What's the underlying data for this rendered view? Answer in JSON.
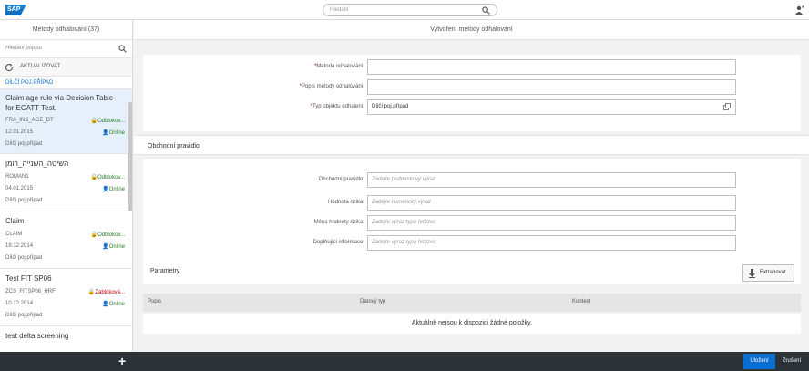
{
  "header": {
    "logo": "SAP",
    "search_placeholder": "Hledání"
  },
  "master": {
    "title": "Metody odhalování (37)",
    "search_placeholder": "Hledání popisu",
    "refresh_label": "AKTUALIZOVAT",
    "group_label": "DÍLČÍ POJ.PŘÍPAD",
    "items": [
      {
        "title1": "Claim age rule via Decision Table",
        "title2": "for ECATT Test.",
        "id": "FRA_INS_AGE_DT",
        "date": "12.01.2015",
        "type": "Dílčí poj.případ",
        "status1": "Odblokov...",
        "status2": "Online",
        "status1_color": "green"
      },
      {
        "title1": "השיטה_השנייה_רומן",
        "title2": "",
        "id": "ROMAN1",
        "date": "04.01.2015",
        "type": "Dílčí poj.případ",
        "status1": "Odblokov...",
        "status2": "Online",
        "status1_color": "green"
      },
      {
        "title1": "Claim",
        "title2": "",
        "id": "CLAIM",
        "date": "19.12.2014",
        "type": "Dílčí poj.případ",
        "status1": "Odblokov...",
        "status2": "Online",
        "status1_color": "green"
      },
      {
        "title1": "Test FIT SP06",
        "title2": "",
        "id": "ZCS_FITSP06_HRF",
        "date": "10.12.2014",
        "type": "Dílčí poj.případ",
        "status1": "Zabloková...",
        "status2": "Online",
        "status1_color": "red"
      },
      {
        "title1": "test delta screening",
        "title2": "",
        "id": "",
        "date": "",
        "type": "",
        "status1": "",
        "status2": "",
        "status1_color": "green"
      }
    ]
  },
  "detail": {
    "title": "Vytvoření metody odhalování",
    "form1": {
      "method_label": "Metoda odhalování:",
      "method_value": "",
      "desc_label": "Popis metody odhalování:",
      "desc_value": "",
      "objtype_label": "Typ objektu odhalení:",
      "objtype_value": "Dílčí poj.případ"
    },
    "section2_title": "Obchodní pravidlo",
    "form2": {
      "rule_label": "Obchodní pravidlo:",
      "rule_placeholder": "Zadejte podmínkový výraz",
      "risk_label": "Hodnota rizika:",
      "risk_placeholder": "Zadejte numerický výraz",
      "unit_label": "Měna hodnoty rizika:",
      "unit_placeholder": "Zadejte výraz typu řetězec",
      "info_label": "Doplňující informace:",
      "info_placeholder": "Zadejte výraz typu řetězec"
    },
    "params_title": "Parametry",
    "extract_label": "Extrahovat",
    "table": {
      "columns": [
        "Popis",
        "Datový typ",
        "Kontext"
      ],
      "empty_text": "Aktuálně nejsou k dispozici žádné položky."
    }
  },
  "footer": {
    "save_label": "Uložení",
    "cancel_label": "Zrušení"
  },
  "colors": {
    "accent": "#0a6ed1",
    "footer_bg": "#2c3338",
    "status_ok": "#2b7d2b",
    "status_blocked": "#bb0000"
  }
}
